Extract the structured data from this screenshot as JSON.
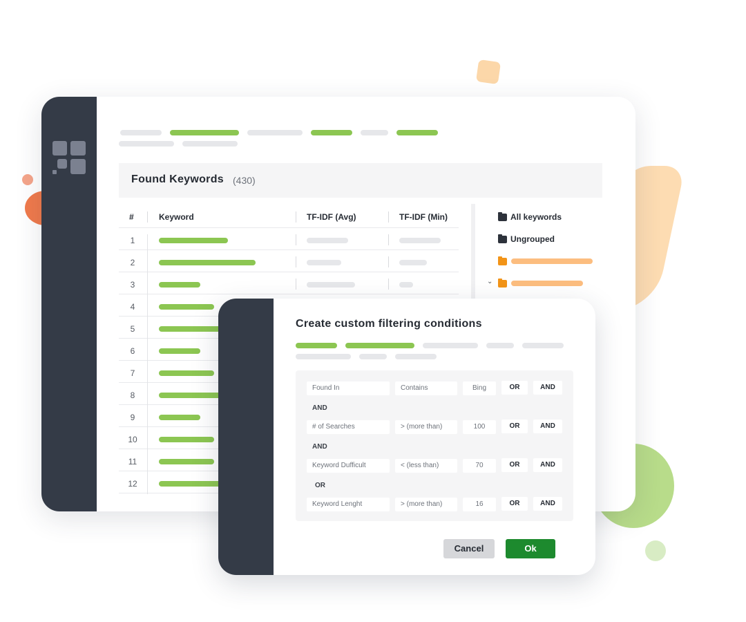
{
  "colors": {
    "sidebar": "#343b47",
    "accent_green": "#8cc652",
    "placeholder_gray": "#e6e7ea",
    "folder_orange": "#f29418",
    "ok_button": "#1d8a2e",
    "cancel_button": "#d6d7da"
  },
  "app": {
    "logo_icon": "grid-squares-logo-icon"
  },
  "keywords_panel": {
    "title": "Found Keywords",
    "count": "(430)",
    "columns": [
      "#",
      "Keyword",
      "TF-IDF (Avg)",
      "TF-IDF (Min)"
    ],
    "rows": [
      "1",
      "2",
      "3",
      "4",
      "5",
      "6",
      "7",
      "8",
      "9",
      "10",
      "11",
      "12"
    ]
  },
  "tree": {
    "all_keywords": "All keywords",
    "ungrouped": "Ungrouped",
    "folder_icon": "folder-icon",
    "expand_icon": "chevron-down-icon"
  },
  "dialog": {
    "title": "Create custom filtering conditions",
    "conditions": [
      {
        "field": "Found In",
        "operator": "Contains",
        "value": "Bing",
        "or_label": "OR",
        "and_label": "AND"
      },
      {
        "field": "# of Searches",
        "operator": "> (more than)",
        "value": "100",
        "or_label": "OR",
        "and_label": "AND"
      },
      {
        "field": "Keyword Dufficult",
        "operator": "< (less than)",
        "value": "70",
        "or_label": "OR",
        "and_label": "AND"
      },
      {
        "field": "Keyword Lenght",
        "operator": "> (more than)",
        "value": "16",
        "or_label": "OR",
        "and_label": "AND"
      }
    ],
    "connectors": [
      "AND",
      "AND",
      "OR"
    ],
    "cancel_label": "Cancel",
    "ok_label": "Ok"
  }
}
